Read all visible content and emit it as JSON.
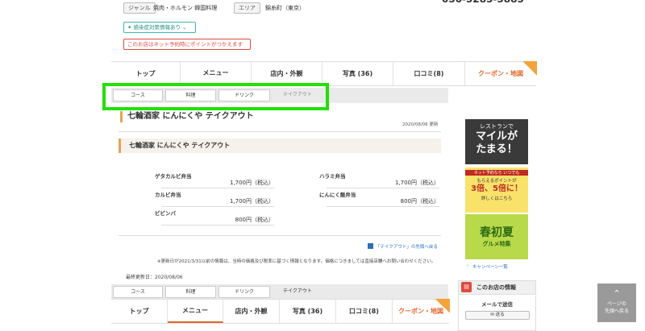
{
  "header": {
    "genre_label": "ジャンル",
    "genre_value": "焼肉・ホルモン 韓国料理",
    "area_label": "エリア",
    "area_value": "錦糸町（東京）",
    "phone_partial": "050-5285-5885",
    "covid_label": "感染症対策情報あり",
    "net_reservation_notice": "このお店はネット予約時にポイントがつかえます"
  },
  "main_tabs": [
    "トップ",
    "メニュー",
    "店内・外観",
    "写真 (36)",
    "口コミ(8)",
    "クーポン・地図"
  ],
  "main_tabs_active": "メニュー",
  "sub_tabs": [
    "コース",
    "料理",
    "ドリンク",
    "テイクアウト"
  ],
  "sub_tabs_active": "テイクアウト",
  "page": {
    "title": "七輪酒家 にんにくや テイクアウト",
    "updated": "2020/08/06 更新",
    "section_title": "七輪酒家 にんにくや テイクアウト"
  },
  "menu_items": [
    {
      "name": "ゲタカルビ弁当",
      "price": "1,700円（税込）"
    },
    {
      "name": "ハラミ弁当",
      "price": "1,700円（税込）"
    },
    {
      "name": "カルビ弁当",
      "price": "1,700円（税込）"
    },
    {
      "name": "にんにく飯弁当",
      "price": "800円（税込）"
    },
    {
      "name": "ビビンバ",
      "price": "800円（税込）"
    }
  ],
  "back_link": "「テイクアウト」の先頭へ戻る",
  "note": "※更新日が2021/3/31以前の情報は、当時の価格及び税率に基づく情報となります。価格につきましては直接店舗へお問い合わせください。",
  "last_updated": "最終更新日：2020/08/06",
  "sidebar": {
    "banner1_line1": "レストランで",
    "banner1_line2": "マイルが",
    "banner1_line3": "たまる！",
    "banner2_line1": "ネット予約なら いつでも",
    "banner2_line2": "もらえるポイントが",
    "banner2_line3": "3倍、5倍に！",
    "banner2_line4": "詳しくはこちら",
    "banner3_line1": "春初夏",
    "banner3_line2": "グルメ特集",
    "campaign_link": "キャンペーン一覧",
    "info_title": "このお店の情報",
    "mail_label": "メールで送信",
    "send_button": "送る"
  },
  "page_top": {
    "line1": "ページの",
    "line2": "先頭へ戻る"
  },
  "colors": {
    "accent": "#e0672b",
    "highlight": "#22e000",
    "net_red": "#e04a3f"
  }
}
